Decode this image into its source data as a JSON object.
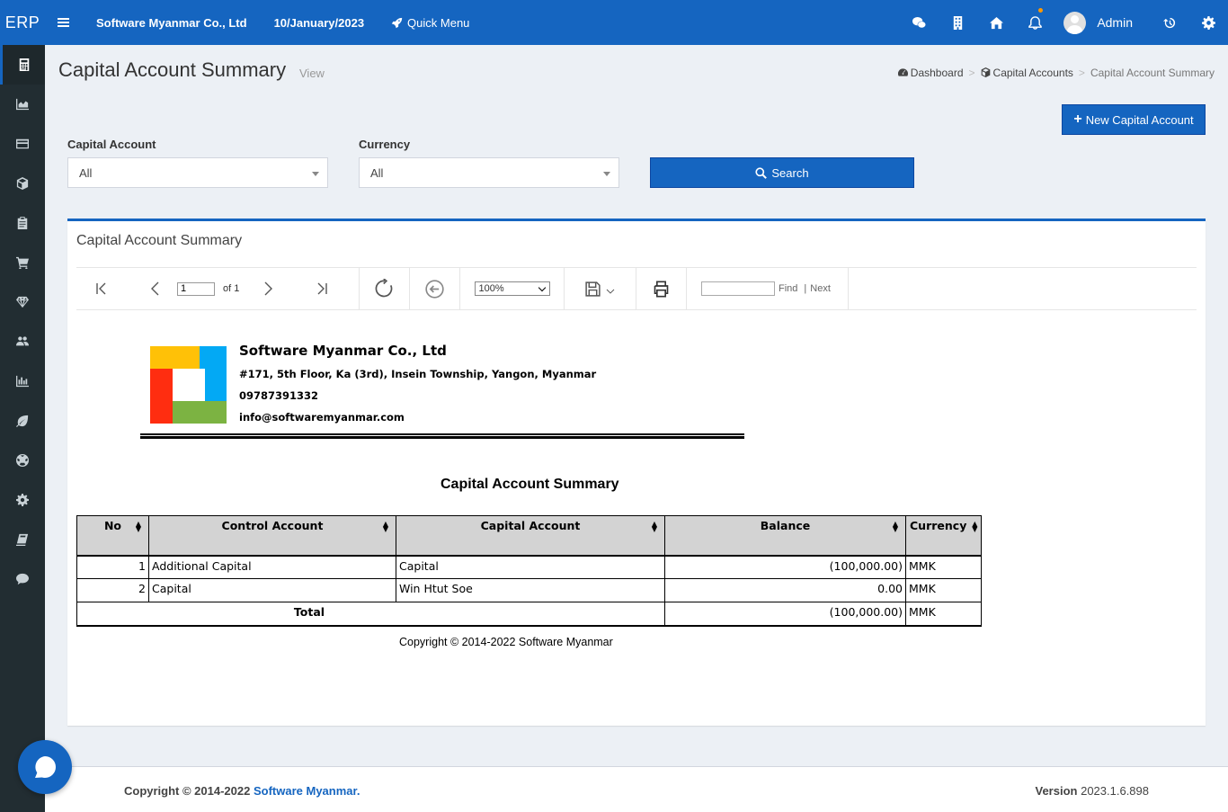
{
  "header": {
    "logo": "ERP",
    "company": "Software Myanmar Co., Ltd",
    "date": "10/January/2023",
    "quick_menu": "Quick Menu",
    "user_name": "Admin"
  },
  "sidebar": {
    "items": [
      "calculator-icon",
      "area-chart-icon",
      "credit-card-icon",
      "cube-icon",
      "clipboard-icon",
      "cart-icon",
      "diamond-icon",
      "users-icon",
      "bar-chart-icon",
      "leaf-icon",
      "soccer-ball-icon",
      "gear-icon",
      "book-icon",
      "comment-icon"
    ]
  },
  "page": {
    "title": "Capital Account Summary",
    "subtitle": "View",
    "breadcrumb": [
      "Dashboard",
      "Capital Accounts",
      "Capital Account Summary"
    ],
    "new_button": "New Capital Account"
  },
  "filters": {
    "capital_account_label": "Capital Account",
    "capital_account_value": "All",
    "currency_label": "Currency",
    "currency_value": "All",
    "search_button": "Search"
  },
  "box": {
    "title": "Capital Account Summary"
  },
  "viewer": {
    "page_number": "1",
    "of_text": "of 1",
    "zoom": "100%",
    "find_label": "Find",
    "separator": "|",
    "next_label": "Next"
  },
  "report": {
    "company": "Software Myanmar Co., Ltd",
    "address": "#171, 5th Floor, Ka (3rd), Insein Township, Yangon, Myanmar",
    "phone": "09787391332",
    "email": "info@softwaremyanmar.com",
    "title": "Capital Account Summary",
    "columns": {
      "no": "No",
      "control_account": "Control Account",
      "capital_account": "Capital Account",
      "balance": "Balance",
      "currency": "Currency"
    },
    "rows": [
      {
        "no": "1",
        "control_account": "Additional Capital",
        "capital_account": "Capital",
        "balance": "(100,000.00)",
        "currency": "MMK"
      },
      {
        "no": "2",
        "control_account": "Capital",
        "capital_account": "Win Htut Soe",
        "balance": "0.00",
        "currency": "MMK"
      }
    ],
    "total": {
      "label": "Total",
      "balance": "(100,000.00)",
      "currency": "MMK"
    },
    "copyright": "Copyright © 2014-2022 Software Myanmar"
  },
  "footer": {
    "copyright_prefix": "Copyright © 2014-2022",
    "copyright_link": "Software Myanmar.",
    "version_label": "Version",
    "version_value": "2023.1.6.898"
  },
  "colors": {
    "primary": "#1565c0",
    "sidebar": "#222d32",
    "background": "#ecf0f5"
  }
}
